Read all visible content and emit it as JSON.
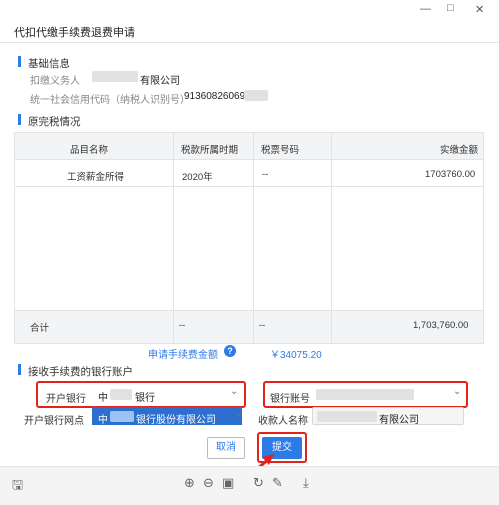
{
  "window": {
    "title": "代扣代缴手续费退费申请",
    "min_icon": "minimize-icon",
    "max_icon": "maximize-icon",
    "close_icon": "close-icon",
    "min_glyph": "—",
    "max_glyph": "□",
    "close_glyph": "✕"
  },
  "basic_info": {
    "title": "基础信息",
    "withholder_label": "扣缴义务人",
    "withholder_value_suffix": "有限公司",
    "credit_code_label": "统一社会信用代码（纳税人识别号）",
    "credit_code_value": "91360826069"
  },
  "tax_section": {
    "title": "原完税情况",
    "headers": [
      "品目名称",
      "税款所属时期",
      "税票号码",
      "实缴金额"
    ],
    "rows": [
      [
        "工资薪金所得",
        "2020年",
        "--",
        "1703760.00"
      ]
    ],
    "total": [
      "合计",
      "--",
      "--",
      "1,703,760.00"
    ]
  },
  "fee": {
    "label": "申请手续费金额",
    "help_icon": "question-icon",
    "help_glyph": "?",
    "value": "￥34075.20"
  },
  "bank_section": {
    "title": "接收手续费的银行账户",
    "bank_label": "开户银行",
    "bank_value_prefix": "中",
    "bank_value_suffix": "银行",
    "account_label": "银行账号",
    "branch_label": "开户银行网点",
    "branch_value_prefix": "中",
    "branch_value_suffix": "银行股份有限公司",
    "payee_label": "收款人名称",
    "payee_value_suffix": "有限公司",
    "dropdown_icon": "chevron-down-icon",
    "dropdown_glyph": "⌄"
  },
  "buttons": {
    "cancel": "取消",
    "submit": "提交"
  },
  "toolbar": {
    "save_glyph": "🖫",
    "zoom_in_glyph": "⊕",
    "zoom_out_glyph": "⊖",
    "fit_glyph": "▣",
    "rotate_glyph": "↻",
    "pen_glyph": "✎",
    "download_glyph": "⤓"
  },
  "colors": {
    "accent": "#2d7be5",
    "highlight_red": "#e2231a"
  }
}
